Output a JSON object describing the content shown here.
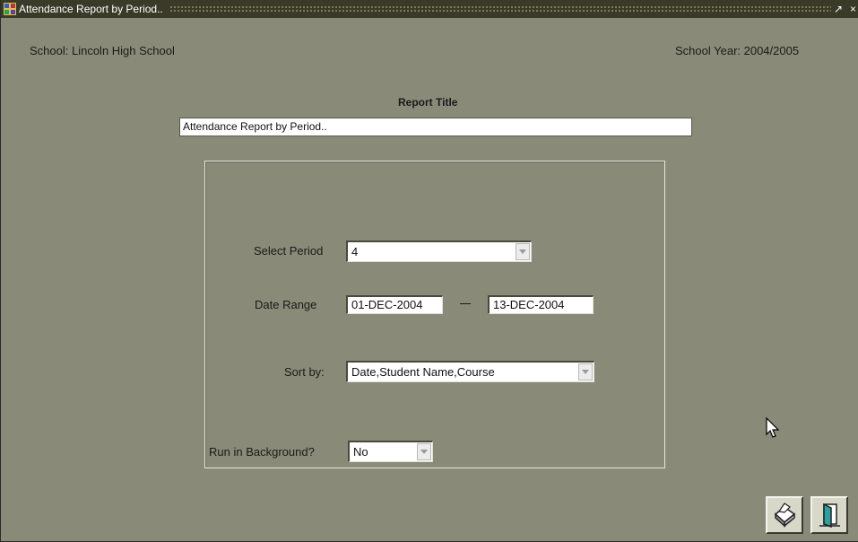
{
  "window": {
    "title": "Attendance Report by Period..",
    "restore_glyph": "↗",
    "close_glyph": "×"
  },
  "header": {
    "school": "School: Lincoln High School",
    "school_year": "School Year: 2004/2005"
  },
  "report": {
    "title_label": "Report Title",
    "title_value": "Attendance Report by Period.."
  },
  "form": {
    "period_label": "Select Period",
    "period_value": "4",
    "date_range_label": "Date Range",
    "date_from": "01-DEC-2004",
    "date_to": "13-DEC-2004",
    "sort_label": "Sort by:",
    "sort_value": "Date,Student Name,Course",
    "background_label": "Run in Background?",
    "background_value": "No"
  },
  "toolbar": {
    "print_icon": "printer-icon",
    "exit_icon": "exit-door-icon"
  },
  "colors": {
    "window_bg": "#8a8a78",
    "titlebar_bg": "#3a3a28"
  }
}
